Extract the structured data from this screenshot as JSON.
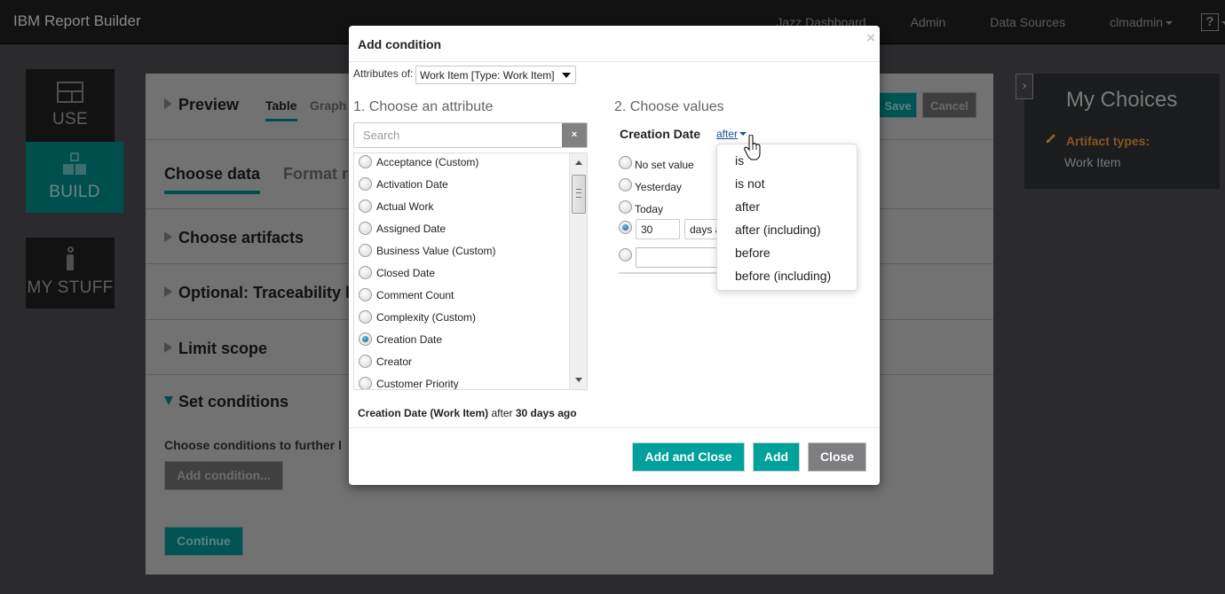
{
  "app": {
    "title": "IBM Report Builder",
    "nav": [
      "Jazz Dashboard",
      "Admin",
      "Data Sources"
    ],
    "user": "clmadmin",
    "help_label": "?"
  },
  "leftnav": {
    "items": [
      {
        "label": "USE",
        "icon": "table-icon",
        "active": false
      },
      {
        "label": "BUILD",
        "icon": "build-blocks-icon",
        "active": true
      },
      {
        "label": "MY STUFF",
        "icon": "person-icon",
        "active": false
      }
    ],
    "active_color": "#004f4f"
  },
  "main": {
    "preview_title": "Preview",
    "view_tabs": [
      "Table",
      "Graph"
    ],
    "save_label": "Save",
    "cancel_label": "Cancel",
    "data_tabs": [
      "Choose data",
      "Format r"
    ],
    "sections": [
      "Choose artifacts",
      "Optional: Traceability l",
      "Limit scope"
    ],
    "set_conditions_title": "Set conditions",
    "set_conditions_desc": "Choose conditions to further l",
    "add_condition_label": "Add condition...",
    "continue_label": "Continue"
  },
  "mychoices": {
    "title": "My Choices",
    "collapse_icon": "chevron-right-icon",
    "artifact_types_label": "Artifact types:",
    "artifact_types_value": "Work Item"
  },
  "modal": {
    "title": "Add condition",
    "close_glyph": "×",
    "attributes_of_label": "Attributes of:",
    "attributes_of_value": "Work Item [Type: Work Item]",
    "step1_title": "1. Choose an attribute",
    "search_placeholder": "Search",
    "search_value": "",
    "search_clear": "×",
    "attributes": [
      {
        "label": "Acceptance (Custom)",
        "selected": false
      },
      {
        "label": "Activation Date",
        "selected": false
      },
      {
        "label": "Actual Work",
        "selected": false
      },
      {
        "label": "Assigned Date",
        "selected": false
      },
      {
        "label": "Business Value (Custom)",
        "selected": false
      },
      {
        "label": "Closed Date",
        "selected": false
      },
      {
        "label": "Comment Count",
        "selected": false
      },
      {
        "label": "Complexity (Custom)",
        "selected": false
      },
      {
        "label": "Creation Date",
        "selected": true
      },
      {
        "label": "Creator",
        "selected": false
      },
      {
        "label": "Customer Priority",
        "selected": false
      }
    ],
    "step2_title": "2. Choose values",
    "value_attribute": "Creation Date",
    "operator": "after",
    "value_options": [
      {
        "label": "No set value",
        "selected": false
      },
      {
        "label": "Yesterday",
        "selected": false
      },
      {
        "label": "Today",
        "selected": false
      }
    ],
    "days_value": "30",
    "days_unit": "days ago",
    "date_value": "",
    "operator_options": [
      "is",
      "is not",
      "after",
      "after (including)",
      "before",
      "before (including)"
    ],
    "summary": {
      "attribute": "Creation Date (Work Item)",
      "operator": "after",
      "value": "30 days ago"
    },
    "buttons": {
      "add_and_close": "Add and Close",
      "add": "Add",
      "close": "Close"
    },
    "accent_color": "#00a19b"
  }
}
